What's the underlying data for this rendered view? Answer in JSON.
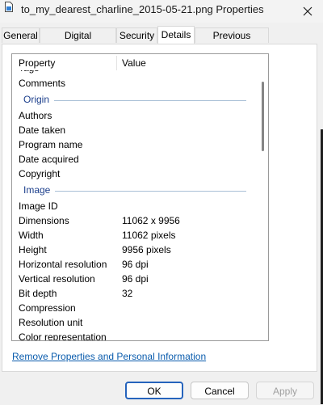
{
  "window": {
    "title": "to_my_dearest_charline_2015-05-21.png Properties",
    "icon": "png-file-icon",
    "close_icon": "close-icon"
  },
  "tabs": [
    {
      "label": "General",
      "active": false
    },
    {
      "label": "Digital Signatures",
      "active": false
    },
    {
      "label": "Security",
      "active": false
    },
    {
      "label": "Details",
      "active": true
    },
    {
      "label": "Previous Versions",
      "active": false
    }
  ],
  "details": {
    "column_property": "Property",
    "column_value": "Value",
    "partial_top_row": "Tags",
    "rows_before": [
      {
        "property": "Comments",
        "value": ""
      }
    ],
    "origin_header": "Origin",
    "origin_rows": [
      {
        "property": "Authors",
        "value": ""
      },
      {
        "property": "Date taken",
        "value": ""
      },
      {
        "property": "Program name",
        "value": ""
      },
      {
        "property": "Date acquired",
        "value": ""
      },
      {
        "property": "Copyright",
        "value": ""
      }
    ],
    "image_header": "Image",
    "image_rows": [
      {
        "property": "Image ID",
        "value": ""
      },
      {
        "property": "Dimensions",
        "value": "11062 x 9956"
      },
      {
        "property": "Width",
        "value": "11062 pixels"
      },
      {
        "property": "Height",
        "value": "9956 pixels"
      },
      {
        "property": "Horizontal resolution",
        "value": "96 dpi"
      },
      {
        "property": "Vertical resolution",
        "value": "96 dpi"
      },
      {
        "property": "Bit depth",
        "value": "32"
      },
      {
        "property": "Compression",
        "value": ""
      },
      {
        "property": "Resolution unit",
        "value": ""
      },
      {
        "property": "Color representation",
        "value": ""
      }
    ]
  },
  "link_remove": "Remove Properties and Personal Information",
  "buttons": {
    "ok": "OK",
    "cancel": "Cancel",
    "apply": "Apply"
  },
  "colors": {
    "accent": "#2563bc",
    "link": "#0a5cad",
    "group_header": "#1c3f8c"
  }
}
